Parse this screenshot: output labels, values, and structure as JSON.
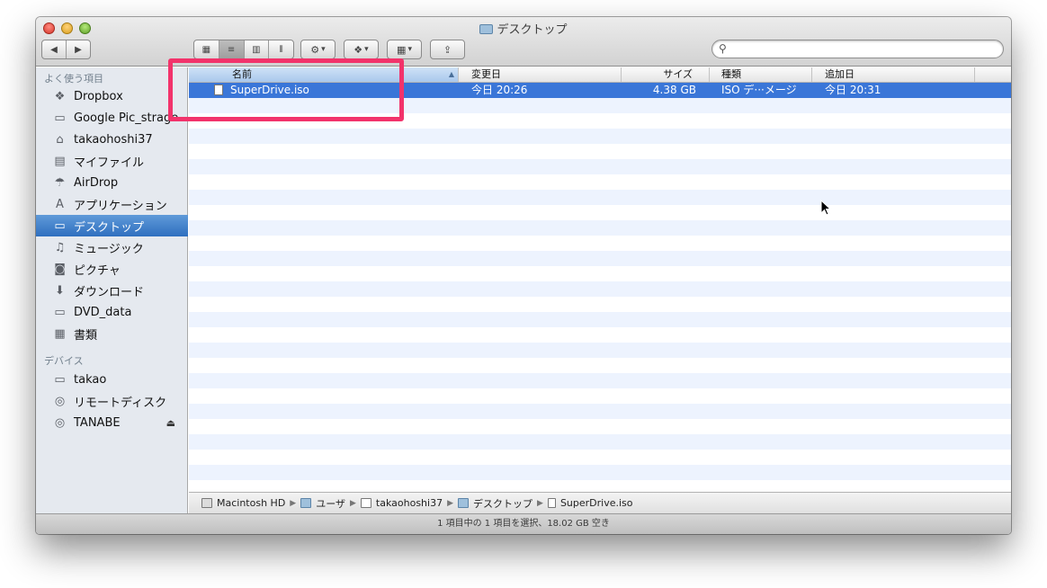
{
  "window": {
    "title": "デスクトップ"
  },
  "toolbar": {
    "back_icon": "◀",
    "forward_icon": "▶",
    "view_icons": [
      "▦",
      "≡",
      "▥",
      "⦀"
    ],
    "action_icon": "⚙",
    "dropbox_icon": "❖",
    "arrange_icon": "▦",
    "share_icon": "⇪",
    "dropdown_icon": "▾",
    "search_placeholder": ""
  },
  "sidebar": {
    "favorites_header": "よく使う項目",
    "favorites": [
      {
        "label": "Dropbox",
        "icon": "dropbox-icon",
        "glyph": "❖"
      },
      {
        "label": "Google Pic_strage",
        "icon": "folder-icon",
        "glyph": "▭"
      },
      {
        "label": "takaohoshi37",
        "icon": "home-icon",
        "glyph": "⌂"
      },
      {
        "label": "マイファイル",
        "icon": "all-files-icon",
        "glyph": "▤"
      },
      {
        "label": "AirDrop",
        "icon": "airdrop-icon",
        "glyph": "☂"
      },
      {
        "label": "アプリケーション",
        "icon": "applications-icon",
        "glyph": "A"
      },
      {
        "label": "デスクトップ",
        "icon": "desktop-icon",
        "glyph": "▭"
      },
      {
        "label": "ミュージック",
        "icon": "music-icon",
        "glyph": "♫"
      },
      {
        "label": "ピクチャ",
        "icon": "camera-icon",
        "glyph": "◙"
      },
      {
        "label": "ダウンロード",
        "icon": "download-icon",
        "glyph": "⬇"
      },
      {
        "label": "DVD_data",
        "icon": "folder-icon",
        "glyph": "▭"
      },
      {
        "label": "書類",
        "icon": "documents-icon",
        "glyph": "▦"
      }
    ],
    "devices_header": "デバイス",
    "devices": [
      {
        "label": "takao",
        "icon": "laptop-icon",
        "glyph": "▭"
      },
      {
        "label": "リモートディスク",
        "icon": "disc-icon",
        "glyph": "◎"
      },
      {
        "label": "TANABE",
        "icon": "disc-icon",
        "glyph": "◎"
      }
    ],
    "eject_icon": "⏏"
  },
  "columns": {
    "name": "名前",
    "sort_arrow": "▲",
    "modified": "変更日",
    "size": "サイズ",
    "kind": "種類",
    "added": "追加日"
  },
  "files": [
    {
      "name": "SuperDrive.iso",
      "modified": "今日 20:26",
      "size": "4.38 GB",
      "kind": "ISO デ···メージ",
      "added": "今日 20:31"
    }
  ],
  "pathbar": {
    "items": [
      "Macintosh HD",
      "ユーザ",
      "takaohoshi37",
      "デスクトップ",
      "SuperDrive.iso"
    ],
    "separator": "▶"
  },
  "status": {
    "text": "1 項目中の 1 項目を選択、18.02 GB 空き"
  },
  "colors": {
    "selection": "#3a76d8",
    "highlight_box": "#f2336b",
    "sidebar_bg": "#e5e9ef"
  }
}
